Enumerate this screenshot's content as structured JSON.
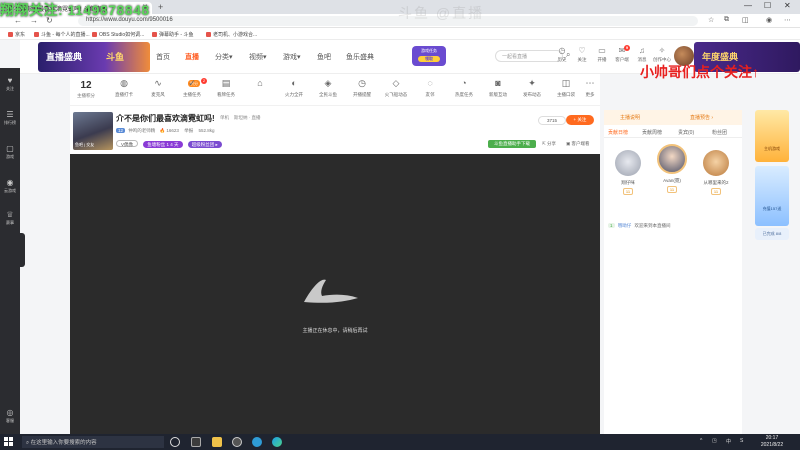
{
  "colors": {
    "accent": "#ff5d23",
    "sidebar": "#2b2c30",
    "player": "#2b2b2b",
    "overlay_green": "#5bd65b",
    "overlay_red": "#e8201f"
  },
  "overlays": {
    "top_left": "翔翔关注: 1149878848",
    "watermark": "斗鱼 @直播",
    "right_red": "小帅哥们点个关注↑"
  },
  "browser": {
    "tab_title": "介不是你们最喜欢滴霓虹吗! 斗鱼直播",
    "url": "https://www.douyu.com/9500016",
    "bookmarks": [
      "京东",
      "斗鱼 - 每个人的直播...",
      "OBS Studio如何调...",
      "弹幕助手 - 斗鱼",
      "老司机、小游戏合..."
    ]
  },
  "header": {
    "logo_text": "直播盛典",
    "logo_sub": "斗鱼",
    "nav": [
      {
        "label": "首页",
        "active": false
      },
      {
        "label": "直播",
        "active": true
      },
      {
        "label": "分类▾",
        "active": false
      },
      {
        "label": "视频▾",
        "active": false
      },
      {
        "label": "游戏▾",
        "active": false
      },
      {
        "label": "鱼吧",
        "active": false
      },
      {
        "label": "鱼乐盛典",
        "active": false
      }
    ],
    "promo": {
      "line1": "游戏任务",
      "line2": "福利",
      "button": "领取"
    },
    "search_placeholder": "一起看直播",
    "icons": [
      {
        "icon": "history-icon",
        "glyph": "◷",
        "label": "历史"
      },
      {
        "icon": "follow-icon",
        "glyph": "♡",
        "label": "关注"
      },
      {
        "icon": "live-icon",
        "glyph": "▭",
        "label": "开播"
      },
      {
        "icon": "message-icon",
        "glyph": "✉",
        "label": "客户端",
        "badge": "9"
      },
      {
        "icon": "bell-icon",
        "glyph": "♫",
        "label": "消息"
      },
      {
        "icon": "bulb-icon",
        "glyph": "✧",
        "label": "创作中心"
      }
    ],
    "banner_text": "年度盛典"
  },
  "left_sidebar": [
    {
      "icon": "heart-icon",
      "glyph": "♥",
      "label": "关注"
    },
    {
      "icon": "list-icon",
      "glyph": "☰",
      "label": "排行榜"
    },
    {
      "icon": "game-icon",
      "glyph": "▢",
      "label": "游戏"
    },
    {
      "icon": "controller-icon",
      "glyph": "◉",
      "label": "云游戏"
    },
    {
      "icon": "trophy-icon",
      "glyph": "♕",
      "label": "赛事"
    },
    {
      "icon": "headset-icon",
      "glyph": "◎",
      "label": "客服"
    }
  ],
  "func_bar": {
    "score": "12",
    "score_label": "主播积分",
    "pill": "积分",
    "badge": "2",
    "items": [
      {
        "icon": "fans-icon",
        "glyph": "◍",
        "label": "直播打卡"
      },
      {
        "icon": "wave-icon",
        "glyph": "∿",
        "label": "麦克风"
      },
      {
        "icon": "task-icon",
        "glyph": "✓",
        "label": "主播任务"
      },
      {
        "icon": "ad-icon",
        "glyph": "▤",
        "label": "看牌任务"
      },
      {
        "icon": "gift-icon",
        "glyph": "⌂",
        "label": ""
      },
      {
        "icon": "fire-icon",
        "glyph": "◐",
        "label": "火力全开"
      },
      {
        "icon": "guard-icon",
        "glyph": "◈",
        "label": "全民斗鱼"
      },
      {
        "icon": "clock-icon",
        "glyph": "⏰",
        "label": "开播提醒"
      },
      {
        "icon": "car-icon",
        "glyph": "◇",
        "label": "火飞船动态"
      },
      {
        "icon": "team-icon",
        "glyph": "◌",
        "label": "友邻"
      },
      {
        "icon": "speed-icon",
        "glyph": "◔",
        "label": "热度任务"
      },
      {
        "icon": "gamepad-icon",
        "glyph": "◙",
        "label": "新版互动"
      },
      {
        "icon": "star-icon",
        "glyph": "✦",
        "label": "发布动态"
      },
      {
        "icon": "pay-icon",
        "glyph": "◫",
        "label": "主播口袋"
      },
      {
        "icon": "chat-icon",
        "glyph": "◻",
        "label": "视频剪辑"
      },
      {
        "icon": "more-icon",
        "glyph": "⋯",
        "label": "更多"
      }
    ]
  },
  "room": {
    "thumb_label": "鱼吧 | 交友",
    "title": "介不是你们最喜欢滴霓虹吗!",
    "category": "单机",
    "category2": "斯坦纳 · 直播",
    "level": "12",
    "anchor": "仲鸣的老师精",
    "fans_count": "16623",
    "report": "举报",
    "weight": "552.8kg",
    "tags": [
      "V偶像",
      "鱼塘粉丝 1 4 天",
      "超级粉丝团 ▸"
    ],
    "follow_count": "3715",
    "follow_label": "+ 关注",
    "green_button": "斗鱼直播助手下载",
    "share": "分享",
    "client": "客户端看"
  },
  "player": {
    "offline_message": "主播正在休息中，请稍后再试"
  },
  "right_panel": {
    "top_tabs": [
      "主播说明",
      "直播预告 ›"
    ],
    "tabs": [
      {
        "label": "贡献日榜",
        "active": true
      },
      {
        "label": "贡献周榜",
        "active": false
      },
      {
        "label": "贵宾(0)",
        "active": false
      },
      {
        "label": "粉丝团",
        "active": false
      }
    ],
    "fans": [
      {
        "name": "翔仔咪",
        "level": "11"
      },
      {
        "name": "Avan(霓)",
        "level": "11"
      },
      {
        "name": "从哪里来的2",
        "level": "11"
      }
    ],
    "chat": {
      "level": "1",
      "user": "哦呦仔",
      "message": "欢迎来到本直播间"
    }
  },
  "right_rail": {
    "card1": "主机游戏",
    "card2": "充值157送",
    "card3": "已完成 8/8"
  },
  "taskbar": {
    "search_placeholder": "在这里输入你要搜索的内容",
    "tray": [
      "^",
      "◳",
      "中",
      "S"
    ],
    "time": "20:17",
    "date": "2021/8/22"
  }
}
